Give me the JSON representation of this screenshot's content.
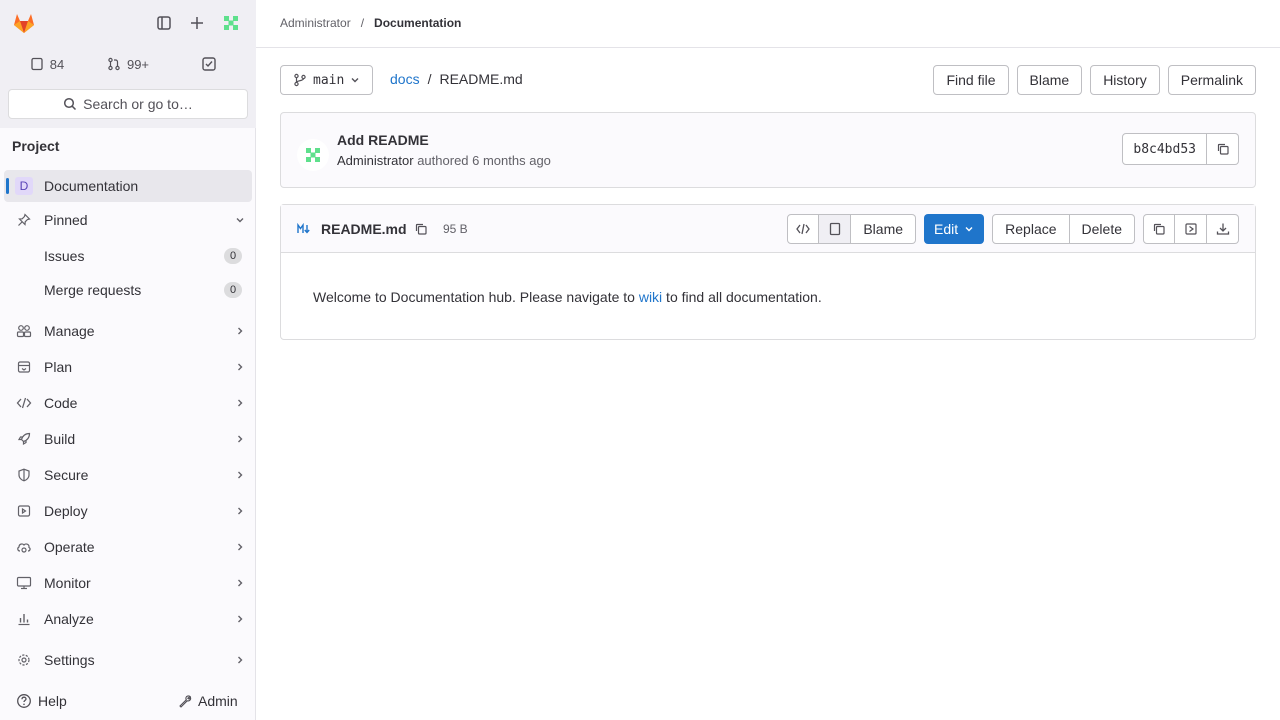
{
  "topbar": {
    "crumbs": [
      "Administrator",
      "Documentation"
    ]
  },
  "sidebar": {
    "counts": {
      "issues": "84",
      "merge_requests": "99+"
    },
    "search_label": "Search or go to…",
    "heading": "Project",
    "project_letter": "D",
    "items": [
      {
        "label": "Documentation"
      },
      {
        "label": "Pinned"
      },
      {
        "label": "Issues",
        "badge": "0"
      },
      {
        "label": "Merge requests",
        "badge": "0"
      },
      {
        "label": "Manage"
      },
      {
        "label": "Plan"
      },
      {
        "label": "Code"
      },
      {
        "label": "Build"
      },
      {
        "label": "Secure"
      },
      {
        "label": "Deploy"
      },
      {
        "label": "Operate"
      },
      {
        "label": "Monitor"
      },
      {
        "label": "Analyze"
      },
      {
        "label": "Settings"
      }
    ],
    "help_label": "Help",
    "admin_label": "Admin"
  },
  "main": {
    "branch": "main",
    "path_root": "docs",
    "path_file": "README.md",
    "actions": [
      "Find file",
      "Blame",
      "History",
      "Permalink"
    ],
    "commit": {
      "title": "Add README",
      "author": "Administrator",
      "meta": "authored 6 months ago",
      "sha": "b8c4bd53"
    },
    "file": {
      "name": "README.md",
      "size": "95 B",
      "blame_label": "Blame",
      "edit_label": "Edit",
      "replace_label": "Replace",
      "delete_label": "Delete",
      "content_before": "Welcome to Documentation hub. Please navigate to ",
      "content_link": "wiki",
      "content_after": " to find all documentation."
    }
  },
  "colors": {
    "accent": "#1f75cb",
    "tanuki": "#e24329"
  }
}
